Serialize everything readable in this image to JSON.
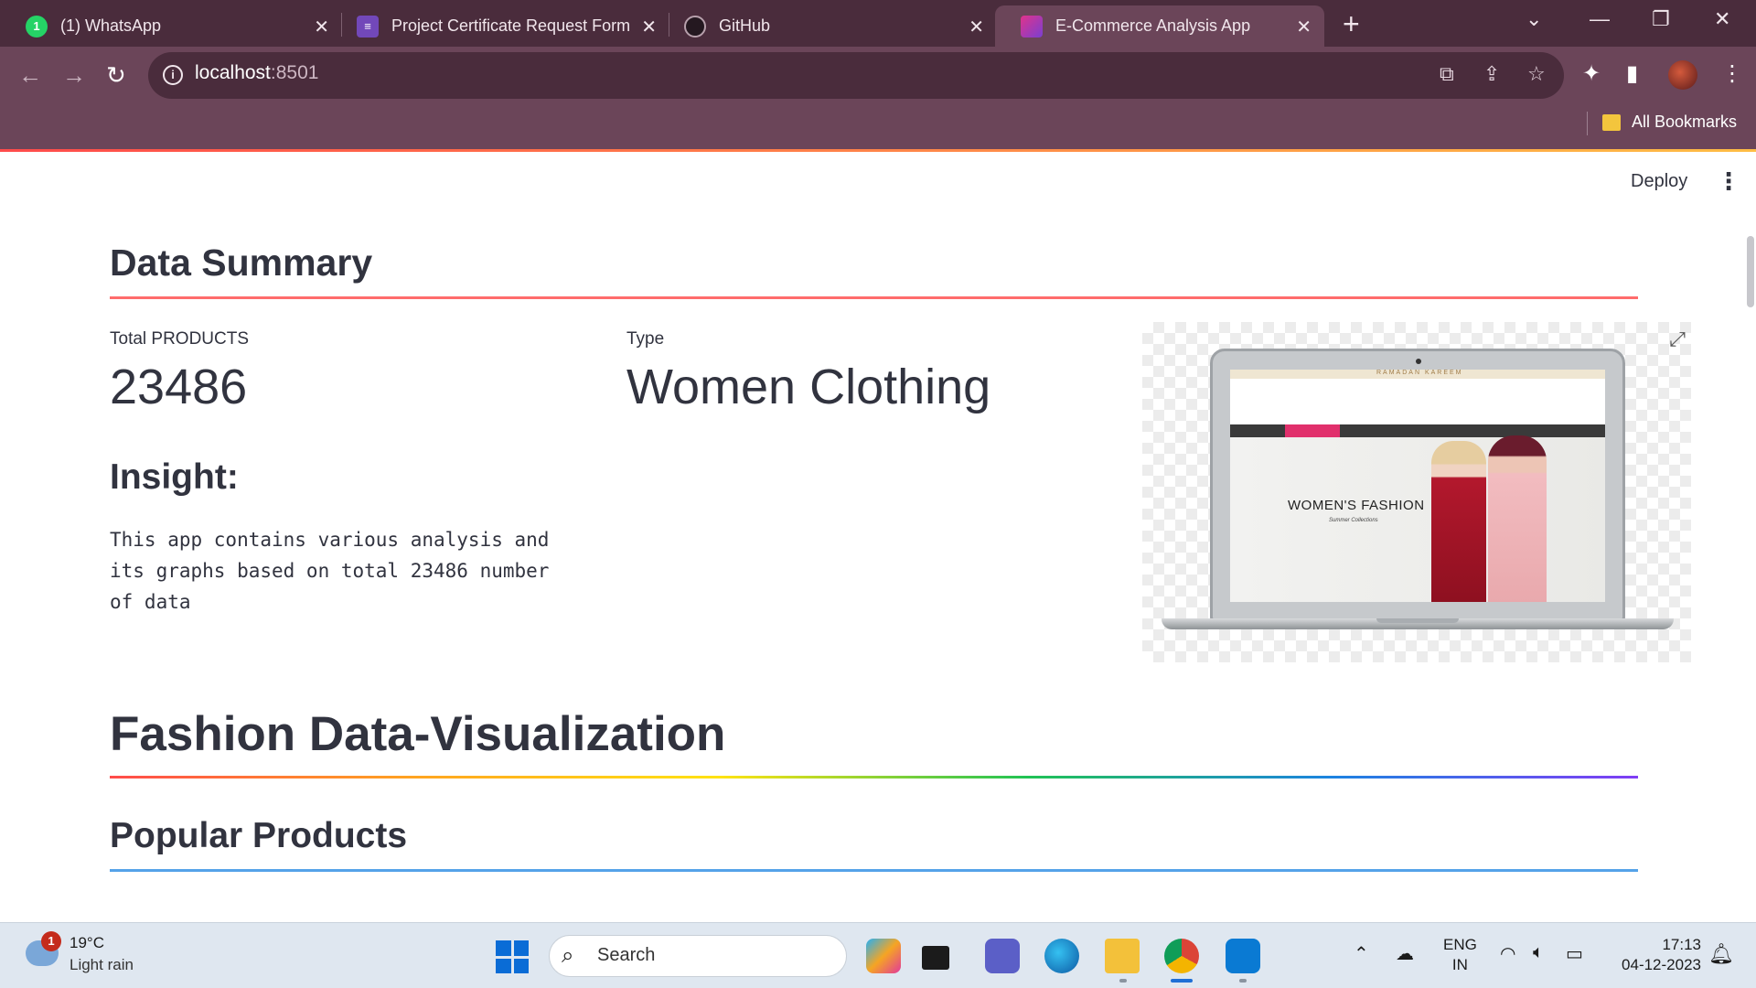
{
  "browser": {
    "tabs": [
      {
        "title": "(1) WhatsApp",
        "icon": "whatsapp-icon",
        "badge": "1"
      },
      {
        "title": "Project Certificate Request Form",
        "icon": "forms-icon"
      },
      {
        "title": "GitHub",
        "icon": "github-icon"
      },
      {
        "title": "E-Commerce Analysis App",
        "icon": "streamlit-app-icon",
        "active": true
      }
    ],
    "url_host": "localhost",
    "url_port": ":8501",
    "bookmarks_label": "All Bookmarks"
  },
  "app": {
    "deploy_label": "Deploy",
    "summary_heading": "Data Summary",
    "metrics": [
      {
        "label": "Total PRODUCTS",
        "value": "23486"
      },
      {
        "label": "Type",
        "value": "Women Clothing"
      }
    ],
    "insight_heading": "Insight:",
    "insight_text": "This app contains various analysis and its graphs based on total 23486 number of data",
    "image": {
      "top_banner": "RAMADAN KAREEM",
      "hero_title": "WOMEN'S FASHION",
      "hero_subtitle": "Summer Collections"
    },
    "viz_heading": "Fashion Data-Visualization",
    "popular_heading": "Popular Products"
  },
  "taskbar": {
    "weather_badge": "1",
    "weather_temp": "19°C",
    "weather_desc": "Light rain",
    "search_label": "Search",
    "lang_line1": "ENG",
    "lang_line2": "IN",
    "time": "17:13",
    "date": "04-12-2023"
  },
  "colors": {
    "chrome_dark": "#4a2c3c",
    "chrome_toolbar": "#6b4559",
    "summary_rule": "#ff6c6c",
    "popular_rule": "#1c83e1",
    "text": "#31333f"
  }
}
